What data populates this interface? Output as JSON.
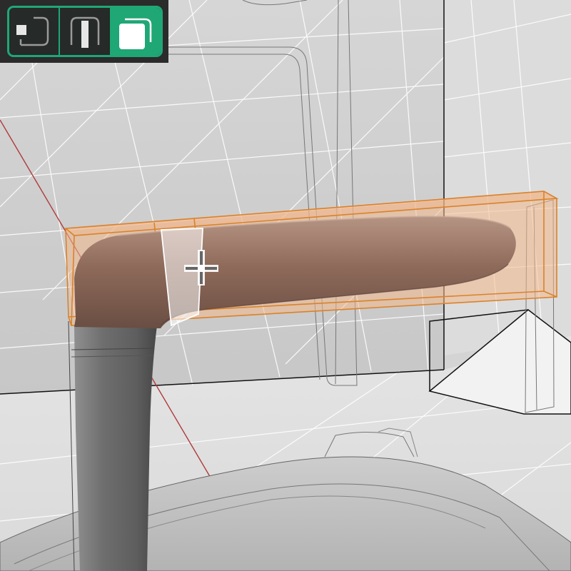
{
  "toolbar": {
    "modes": [
      {
        "icon": "vertex-select-icon",
        "active": false
      },
      {
        "icon": "edge-select-icon",
        "active": false
      },
      {
        "icon": "face-select-icon",
        "active": true
      }
    ],
    "accent_color": "#1fa776",
    "background_color": "#2b2b2b"
  },
  "viewport": {
    "background_color": "#d4d4d4",
    "selection_color": "#e8a060",
    "object_color": "#8e6a5a",
    "x_axis_color": "#b03a3a",
    "y_axis_color": "#4a9a3a"
  }
}
